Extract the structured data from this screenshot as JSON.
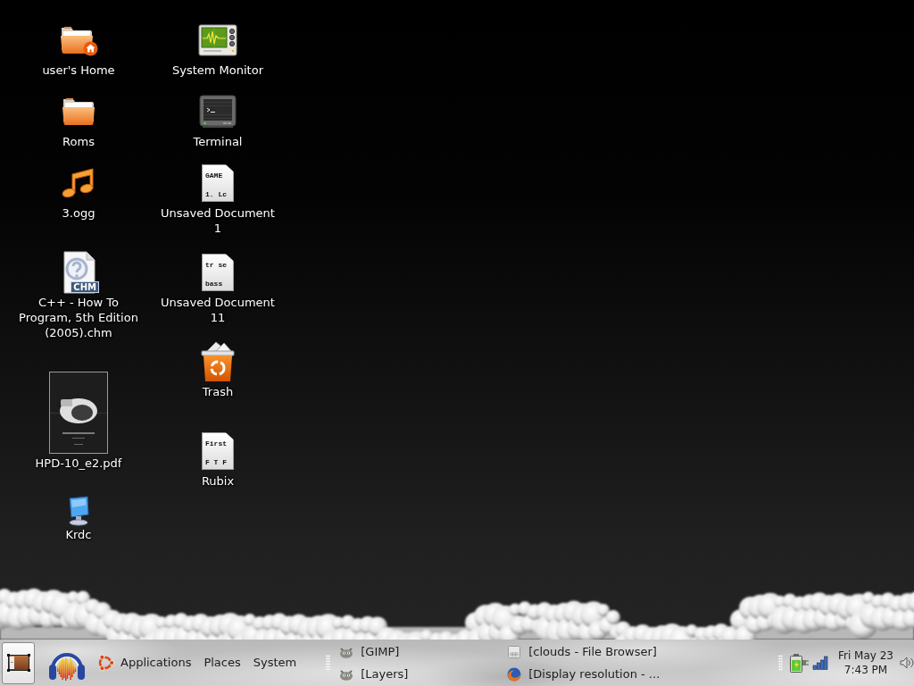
{
  "desktop": {
    "columns": [
      {
        "icons": [
          {
            "kind": "home-folder",
            "label": "user's Home"
          },
          {
            "kind": "folder",
            "label": "Roms"
          },
          {
            "kind": "audio",
            "label": "3.ogg"
          },
          {
            "kind": "help-document",
            "label": "C++ - How To Program, 5th Edition (2005).chm",
            "tag": "CHM"
          },
          {
            "kind": "pdf",
            "label": "HPD-10_e2.pdf"
          },
          {
            "kind": "remote-desktop",
            "label": "Krdc"
          }
        ]
      },
      {
        "icons": [
          {
            "kind": "system-monitor",
            "label": "System Monitor"
          },
          {
            "kind": "terminal",
            "label": "Terminal"
          },
          {
            "kind": "text-document",
            "label": "Unsaved Document 1",
            "preview": [
              "GAME",
              "1. Lc"
            ]
          },
          {
            "kind": "text-document",
            "label": "Unsaved Document 11",
            "preview": [
              "tr se",
              "bass"
            ]
          },
          {
            "kind": "trash",
            "label": "Trash"
          },
          {
            "kind": "text-document",
            "label": "Rubix",
            "preview": [
              "First",
              "F T F"
            ]
          }
        ]
      }
    ]
  },
  "panel": {
    "launchers": [
      {
        "kind": "show-desktop"
      },
      {
        "kind": "audio-editor"
      }
    ],
    "menus": [
      "Applications",
      "Places",
      "System"
    ],
    "window_list": [
      {
        "kind": "image-editor",
        "label": "[GIMP]"
      },
      {
        "kind": "image-editor",
        "label": "[Layers]"
      },
      {
        "kind": "file-browser",
        "label": "[clouds - File Browser]"
      },
      {
        "kind": "web-browser",
        "label": "[Display resolution - ..."
      }
    ],
    "tray": [
      {
        "kind": "battery"
      },
      {
        "kind": "network"
      }
    ],
    "clock": {
      "date": "Fri May 23",
      "time": "7:43 PM"
    },
    "applets": [
      {
        "kind": "volume"
      }
    ]
  }
}
